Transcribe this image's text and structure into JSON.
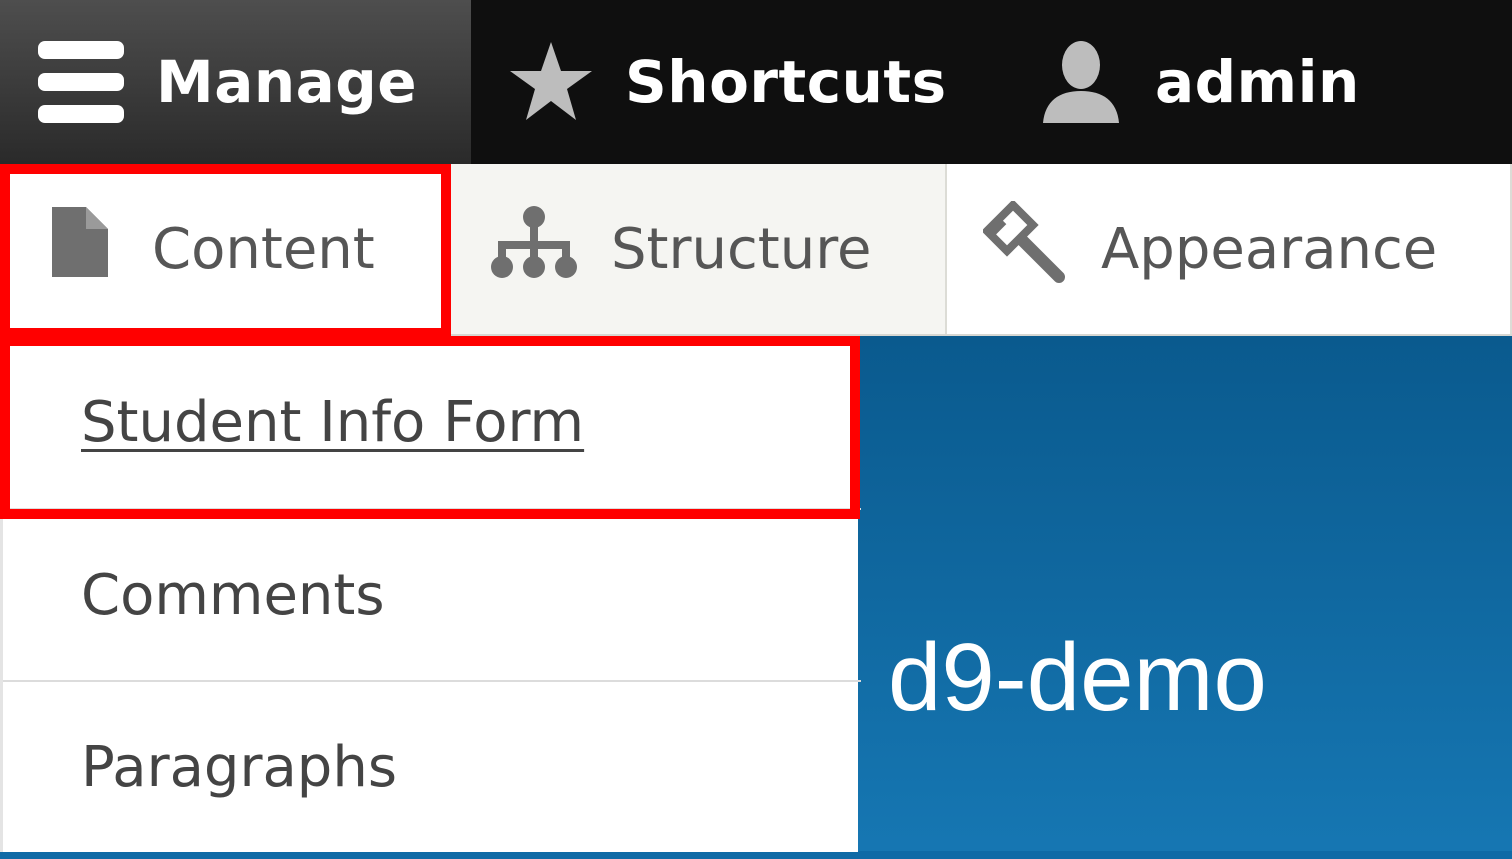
{
  "toolbar": {
    "manage": {
      "label": "Manage",
      "icon": "hamburger-icon"
    },
    "shortcuts": {
      "label": "Shortcuts",
      "icon": "star-icon"
    },
    "user": {
      "label": "admin",
      "icon": "user-icon"
    }
  },
  "tray": {
    "items": [
      {
        "label": "Content",
        "icon": "document-icon"
      },
      {
        "label": "Structure",
        "icon": "sitemap-icon"
      },
      {
        "label": "Appearance",
        "icon": "paintbrush-icon"
      }
    ]
  },
  "dropdown": {
    "items": [
      {
        "label": "Student Info Form"
      },
      {
        "label": "Comments"
      },
      {
        "label": "Paragraphs"
      }
    ]
  },
  "site": {
    "name": "d9-demo"
  },
  "colors": {
    "toolbar_bg": "#0f0f0f",
    "manage_bg": "#3a3a3a",
    "highlight": "#ff0000",
    "site_blue": "#0f6aa6"
  }
}
